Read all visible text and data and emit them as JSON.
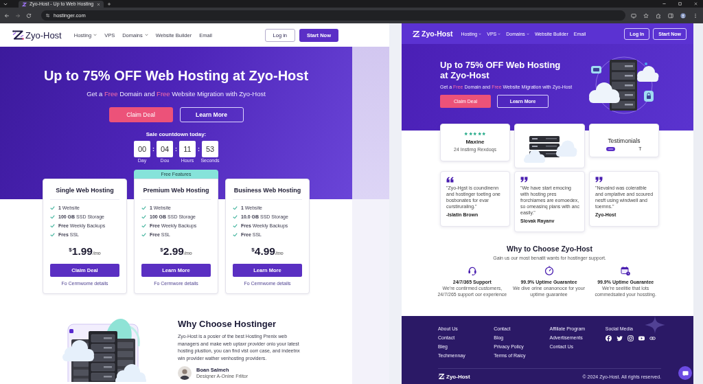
{
  "browser": {
    "tab": {
      "title": "Zyo-Host - Up to Web Hosting",
      "selected": true
    },
    "url": "hostinger.com"
  },
  "main_page": {
    "header": {
      "brand": "Zyo-Host",
      "nav": [
        {
          "label": "Hosting",
          "dropdown": true
        },
        {
          "label": "VPS",
          "dropdown": false
        },
        {
          "label": "Domains",
          "dropdown": true
        },
        {
          "label": "Website Builder",
          "dropdown": false
        },
        {
          "label": "Email",
          "dropdown": false
        }
      ],
      "buttons": [
        {
          "label": "Log in",
          "kind": "outline"
        },
        {
          "label": "Start Now",
          "kind": "solid"
        }
      ]
    },
    "hero": {
      "title": "Up to 75% OFF Web Hosting at Zyo-Host",
      "subtitle": [
        {
          "text": "Get a ",
          "highlight": false
        },
        {
          "text": "Free",
          "highlight": true
        },
        {
          "text": " Domain and ",
          "highlight": false
        },
        {
          "text": "Free",
          "highlight": true
        },
        {
          "text": " Website Migration with Zyo-Host",
          "highlight": false
        }
      ],
      "buttons": [
        {
          "label": "Claim Deal",
          "kind": "accent"
        },
        {
          "label": "Learn More",
          "kind": "outline"
        }
      ]
    },
    "countdown": {
      "label": "Sale countdown today:",
      "separator": ":",
      "units": [
        {
          "value": "00",
          "label": "Day"
        },
        {
          "value": "04",
          "label": "Dou"
        },
        {
          "value": "11",
          "label": "Hours"
        },
        {
          "value": "53",
          "label": "Seconds"
        }
      ]
    },
    "plans": [
      {
        "name": "Single Web Hosting",
        "features": [
          "**1** Website",
          "**100 GB** SSD Storage",
          "**Free** Weekly Backups",
          "**Fres** SSL"
        ],
        "price": {
          "currency": "$",
          "amount": "1.99",
          "period": "/mo"
        },
        "button": "Claim Deal",
        "link": "Fo Cermwome details"
      },
      {
        "badge": "Free Features",
        "name": "Premium Web Hosting",
        "features": [
          "**1** Website",
          "**100 GB** SSD Storage",
          "**Free** Weekly Backups",
          "**Free** SSL"
        ],
        "price": {
          "currency": "$",
          "amount": "2.99",
          "period": "/mo"
        },
        "button": "Learn More",
        "link": "Fo Cermwore details"
      },
      {
        "name": "Business Web Hosting",
        "features": [
          "**1** Website",
          "**10.0 GB** SSD Storage",
          "**Fres** Weekly Backups",
          "**Free** SSL"
        ],
        "price": {
          "currency": "$",
          "amount": "4.99",
          "period": "/mo"
        },
        "button": "Learn More",
        "link": "Fo Cermwome details"
      }
    ],
    "why": {
      "title": "Why Choose Hostinger",
      "text": "Zyo-Host is a posier of the best Hosting Prenix web managers and make web uptaxr provider onio your latest hosting plustion, you can find vist oorr case, and indeetnx win provider wather venhosting providers.",
      "author": {
        "name": "Boan Salmeh",
        "role": "Desiqner A-Onine Frlitor"
      }
    }
  },
  "preview": {
    "header": {
      "brand": "Zyo-Host",
      "nav": [
        {
          "label": "Hosting",
          "dropdown": true
        },
        {
          "label": "VPS",
          "dropdown": true
        },
        {
          "label": "Domains",
          "dropdown": true
        },
        {
          "label": "Website Builder",
          "dropdown": false
        },
        {
          "label": "Email",
          "dropdown": false
        }
      ],
      "buttons": [
        {
          "label": "Log In",
          "kind": "outline"
        },
        {
          "label": "Start Now",
          "kind": "outline"
        }
      ]
    },
    "hero": {
      "title": "Up to 75% OFF Web Hosting at Zyo-Host",
      "subtitle": [
        {
          "text": "Get a ",
          "highlight": false
        },
        {
          "text": "Free",
          "highlight": true
        },
        {
          "text": " Domain and ",
          "highlight": false
        },
        {
          "text": "Free",
          "highlight": true
        },
        {
          "text": " Website Migration with Zyo-Host",
          "highlight": false
        }
      ],
      "buttons": [
        {
          "label": "Claim Deal",
          "kind": "accent"
        },
        {
          "label": "Learn More",
          "kind": "outline"
        }
      ]
    },
    "highlights": [
      {
        "kind": "rating",
        "stars": 5,
        "name": "Maxine",
        "caption": "24 Instimg Rexdoqs"
      },
      {
        "kind": "illustration"
      },
      {
        "kind": "label",
        "title": "Testimonials",
        "tag": "T"
      }
    ],
    "testimonials": [
      {
        "kind": "open-quote",
        "quote": "\"Zyo-Hgst is coundinenn and hostinger toeting one bosbonates for evar curstiruraling.\"",
        "author": "-Islatin Brown"
      },
      {
        "kind": "close-quote",
        "quote": "\"We have start emocing with hosting pres frorchiames are eomoedex, so omeasinq plans with anc easily.\"",
        "author": "Slovak Rayanv"
      },
      {
        "kind": "close-quote",
        "quote": "\"Nevalnd was coleratble and omplative and scoured nesft using windwell and toemns.\"",
        "author": "Zyo-Host"
      }
    ],
    "why": {
      "title": "Why to Choose Zyo-Host",
      "subtitle": "Gain us our most benatit wants for hostinger support.",
      "features": [
        {
          "kind": "support",
          "title": "24/7/365 Support",
          "text": "We're contirmed customers, 24/7/265 support oor experience"
        },
        {
          "kind": "uptime",
          "title": "99.9% Uptime Guarantee",
          "text": "We dive orine onanonoce for your uptime guarantee"
        },
        {
          "kind": "calendar",
          "title": "99.9% Uptime Guarantee",
          "text": "We're seelitie that lots commedsated your hossting."
        }
      ]
    },
    "footer": {
      "columns": [
        {
          "kind": "links",
          "links": [
            "About Us",
            "Contact",
            "Bleg",
            "Techmennay"
          ]
        },
        {
          "kind": "links",
          "links": [
            "Contact",
            "Blog",
            "Privacy Policy",
            "Terms of Raicy"
          ]
        },
        {
          "kind": "links",
          "links": [
            "Affiliate Program",
            "Advertisements",
            "Contact Us"
          ]
        },
        {
          "kind": "social",
          "heading": "Social Media"
        }
      ],
      "brand": "Zyo-Host",
      "copyright": "© 2024 Zyo-Host. All rights reserved."
    }
  }
}
